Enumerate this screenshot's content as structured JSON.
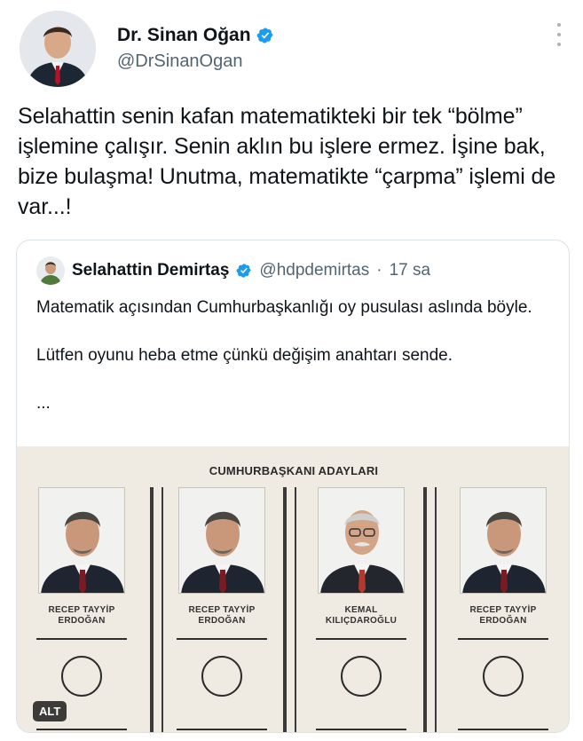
{
  "tweet": {
    "author": {
      "name": "Dr. Sinan Oğan",
      "handle": "@DrSinanOgan",
      "verified": true
    },
    "text": "Selahattin senin kafan matematikteki bir tek “bölme” işlemine çalışır. Senin aklın bu işlere ermez. İşine bak, bize bulaşma! Unutma, matematikte “çarpma” işlemi de var...!"
  },
  "quote": {
    "author": {
      "name": "Selahattin Demirtaş",
      "handle": "@hdpdemirtas",
      "separator": "·",
      "time": "17 sa",
      "verified": true
    },
    "paragraphs": [
      "Matematik açısından Cumhurbaşkanlığı oy pusulası aslında böyle.",
      "Lütfen oyunu heba etme çünkü değişim anahtarı sende.",
      "..."
    ],
    "image": {
      "title": "CUMHURBAŞKANI ADAYLARI",
      "alt_label": "ALT",
      "candidates": [
        {
          "line1": "RECEP TAYYİP",
          "line2": "ERDOĞAN"
        },
        {
          "line1": "RECEP TAYYİP",
          "line2": "ERDOĞAN"
        },
        {
          "line1": "KEMAL",
          "line2": "KILIÇDAROĞLU"
        },
        {
          "line1": "RECEP TAYYİP",
          "line2": "ERDOĞAN"
        }
      ]
    }
  },
  "icons": {
    "verified": "verified-badge-icon",
    "more": "more-options-icon"
  },
  "colors": {
    "accent": "#1d9bf0",
    "text": "#0f1419",
    "secondary": "#536471",
    "border": "#dbe2e8"
  }
}
